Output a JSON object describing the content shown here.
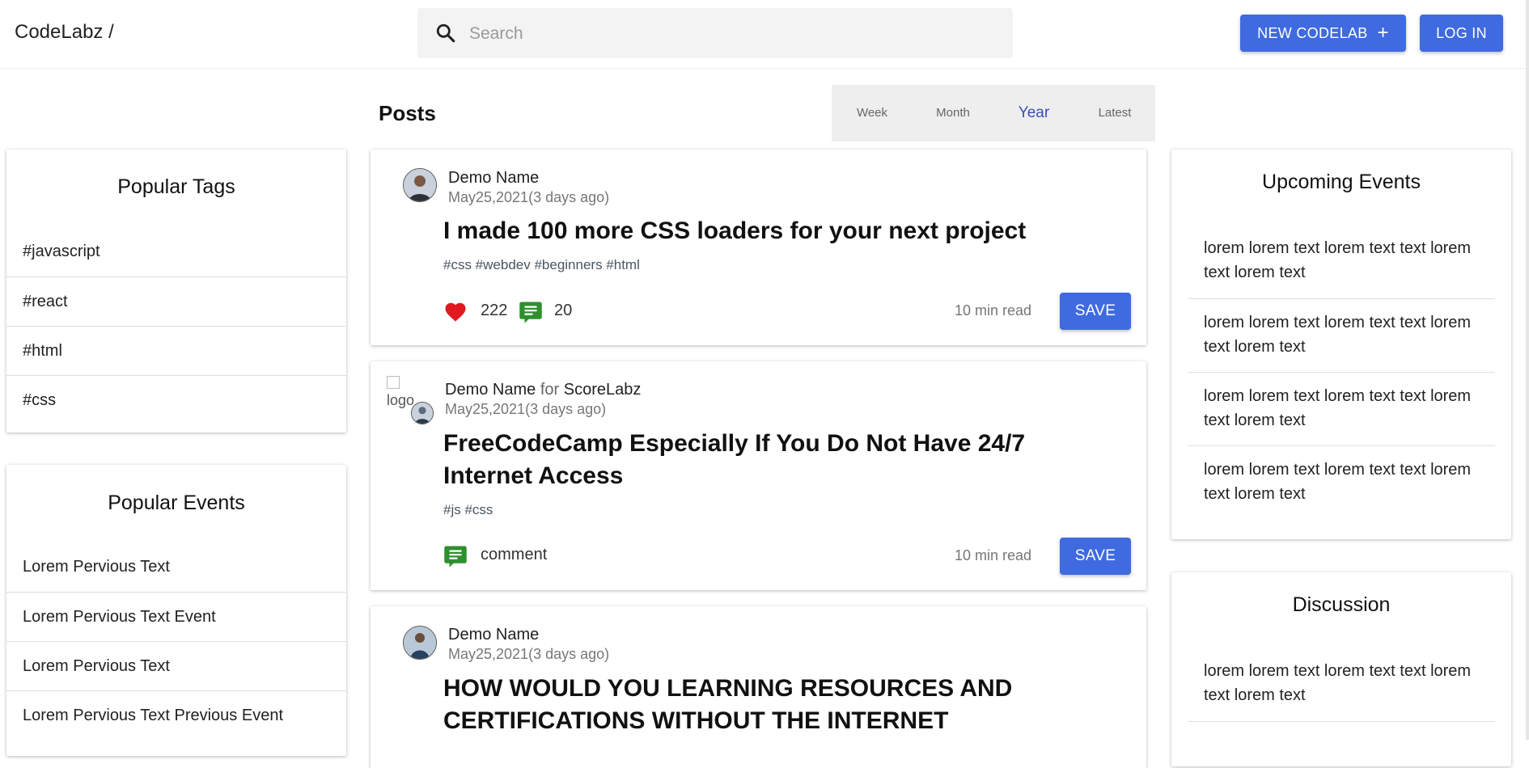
{
  "header": {
    "brand": "CodeLabz /",
    "search_placeholder": "Search",
    "new_codelab_label": "NEW CODELAB",
    "new_codelab_icon": "plus-icon",
    "login_label": "LOG IN"
  },
  "popular_tags": {
    "title": "Popular Tags",
    "items": [
      {
        "label": "#javascript"
      },
      {
        "label": "#react"
      },
      {
        "label": "#html"
      },
      {
        "label": "#css"
      }
    ]
  },
  "popular_events": {
    "title": "Popular Events",
    "items": [
      {
        "label": "Lorem Pervious Text"
      },
      {
        "label": "Lorem Pervious Text Event"
      },
      {
        "label": "Lorem Pervious Text"
      },
      {
        "label": "Lorem Pervious Text Previous Event"
      }
    ]
  },
  "posts": {
    "title": "Posts",
    "filters": [
      {
        "label": "Week"
      },
      {
        "label": "Month"
      },
      {
        "label": "Year",
        "active": true
      },
      {
        "label": "Latest"
      }
    ],
    "items": [
      {
        "author": "Demo Name",
        "date": "May25,2021(3 days ago)",
        "title": "I made 100 more CSS loaders for your next project",
        "tags": "#css #webdev #beginners #html",
        "likes": "222",
        "comments": "20",
        "read_time": "10 min read",
        "save_label": "SAVE"
      },
      {
        "author": "Demo Name",
        "for_label": "for",
        "org": "ScoreLabz",
        "logo_alt": "logo",
        "date": "May25,2021(3 days ago)",
        "title_line1": "FreeCodeCamp Especially If You Do Not Have 24/7",
        "title_line2": "Internet Access",
        "tags": "#js #css",
        "comment_label": "comment",
        "read_time": "10 min read",
        "save_label": "SAVE"
      },
      {
        "author": "Demo Name",
        "date": "May25,2021(3 days ago)",
        "title_line1": "HOW WOULD YOU LEARNING RESOURCES AND",
        "title_line2": "CERTIFICATIONS WITHOUT THE INTERNET"
      }
    ]
  },
  "upcoming_events": {
    "title": "Upcoming Events",
    "items": [
      {
        "line1": "lorem lorem text lorem text text lorem",
        "line2": "text lorem text"
      },
      {
        "line1": "lorem lorem text lorem text text lorem",
        "line2": "text lorem text"
      },
      {
        "line1": "lorem lorem text lorem text text lorem",
        "line2": "text lorem text"
      },
      {
        "line1": "lorem lorem text lorem text text lorem",
        "line2": "text lorem text"
      }
    ]
  },
  "discussion": {
    "title": "Discussion",
    "items": [
      {
        "line1": "lorem lorem text lorem text text lorem",
        "line2": "text lorem text"
      }
    ]
  },
  "colors": {
    "accent_blue": "#3f6ae0",
    "heart_red": "#e0191f",
    "comment_green": "#2f8f2f",
    "active_filter": "#3a4fb0"
  }
}
